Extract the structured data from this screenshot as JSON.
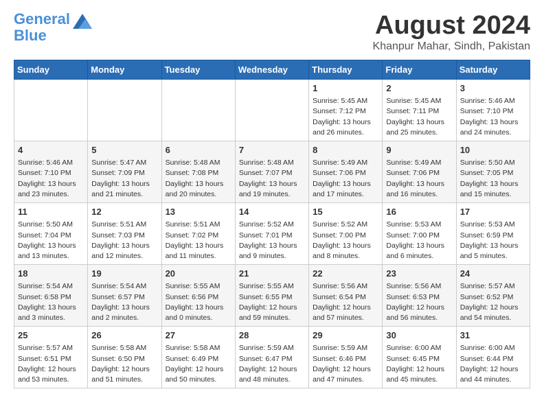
{
  "logo": {
    "line1": "General",
    "line2": "Blue"
  },
  "title": "August 2024",
  "subtitle": "Khanpur Mahar, Sindh, Pakistan",
  "headers": [
    "Sunday",
    "Monday",
    "Tuesday",
    "Wednesday",
    "Thursday",
    "Friday",
    "Saturday"
  ],
  "weeks": [
    [
      {
        "day": "",
        "info": ""
      },
      {
        "day": "",
        "info": ""
      },
      {
        "day": "",
        "info": ""
      },
      {
        "day": "",
        "info": ""
      },
      {
        "day": "1",
        "info": "Sunrise: 5:45 AM\nSunset: 7:12 PM\nDaylight: 13 hours\nand 26 minutes."
      },
      {
        "day": "2",
        "info": "Sunrise: 5:45 AM\nSunset: 7:11 PM\nDaylight: 13 hours\nand 25 minutes."
      },
      {
        "day": "3",
        "info": "Sunrise: 5:46 AM\nSunset: 7:10 PM\nDaylight: 13 hours\nand 24 minutes."
      }
    ],
    [
      {
        "day": "4",
        "info": "Sunrise: 5:46 AM\nSunset: 7:10 PM\nDaylight: 13 hours\nand 23 minutes."
      },
      {
        "day": "5",
        "info": "Sunrise: 5:47 AM\nSunset: 7:09 PM\nDaylight: 13 hours\nand 21 minutes."
      },
      {
        "day": "6",
        "info": "Sunrise: 5:48 AM\nSunset: 7:08 PM\nDaylight: 13 hours\nand 20 minutes."
      },
      {
        "day": "7",
        "info": "Sunrise: 5:48 AM\nSunset: 7:07 PM\nDaylight: 13 hours\nand 19 minutes."
      },
      {
        "day": "8",
        "info": "Sunrise: 5:49 AM\nSunset: 7:06 PM\nDaylight: 13 hours\nand 17 minutes."
      },
      {
        "day": "9",
        "info": "Sunrise: 5:49 AM\nSunset: 7:06 PM\nDaylight: 13 hours\nand 16 minutes."
      },
      {
        "day": "10",
        "info": "Sunrise: 5:50 AM\nSunset: 7:05 PM\nDaylight: 13 hours\nand 15 minutes."
      }
    ],
    [
      {
        "day": "11",
        "info": "Sunrise: 5:50 AM\nSunset: 7:04 PM\nDaylight: 13 hours\nand 13 minutes."
      },
      {
        "day": "12",
        "info": "Sunrise: 5:51 AM\nSunset: 7:03 PM\nDaylight: 13 hours\nand 12 minutes."
      },
      {
        "day": "13",
        "info": "Sunrise: 5:51 AM\nSunset: 7:02 PM\nDaylight: 13 hours\nand 11 minutes."
      },
      {
        "day": "14",
        "info": "Sunrise: 5:52 AM\nSunset: 7:01 PM\nDaylight: 13 hours\nand 9 minutes."
      },
      {
        "day": "15",
        "info": "Sunrise: 5:52 AM\nSunset: 7:00 PM\nDaylight: 13 hours\nand 8 minutes."
      },
      {
        "day": "16",
        "info": "Sunrise: 5:53 AM\nSunset: 7:00 PM\nDaylight: 13 hours\nand 6 minutes."
      },
      {
        "day": "17",
        "info": "Sunrise: 5:53 AM\nSunset: 6:59 PM\nDaylight: 13 hours\nand 5 minutes."
      }
    ],
    [
      {
        "day": "18",
        "info": "Sunrise: 5:54 AM\nSunset: 6:58 PM\nDaylight: 13 hours\nand 3 minutes."
      },
      {
        "day": "19",
        "info": "Sunrise: 5:54 AM\nSunset: 6:57 PM\nDaylight: 13 hours\nand 2 minutes."
      },
      {
        "day": "20",
        "info": "Sunrise: 5:55 AM\nSunset: 6:56 PM\nDaylight: 13 hours\nand 0 minutes."
      },
      {
        "day": "21",
        "info": "Sunrise: 5:55 AM\nSunset: 6:55 PM\nDaylight: 12 hours\nand 59 minutes."
      },
      {
        "day": "22",
        "info": "Sunrise: 5:56 AM\nSunset: 6:54 PM\nDaylight: 12 hours\nand 57 minutes."
      },
      {
        "day": "23",
        "info": "Sunrise: 5:56 AM\nSunset: 6:53 PM\nDaylight: 12 hours\nand 56 minutes."
      },
      {
        "day": "24",
        "info": "Sunrise: 5:57 AM\nSunset: 6:52 PM\nDaylight: 12 hours\nand 54 minutes."
      }
    ],
    [
      {
        "day": "25",
        "info": "Sunrise: 5:57 AM\nSunset: 6:51 PM\nDaylight: 12 hours\nand 53 minutes."
      },
      {
        "day": "26",
        "info": "Sunrise: 5:58 AM\nSunset: 6:50 PM\nDaylight: 12 hours\nand 51 minutes."
      },
      {
        "day": "27",
        "info": "Sunrise: 5:58 AM\nSunset: 6:49 PM\nDaylight: 12 hours\nand 50 minutes."
      },
      {
        "day": "28",
        "info": "Sunrise: 5:59 AM\nSunset: 6:47 PM\nDaylight: 12 hours\nand 48 minutes."
      },
      {
        "day": "29",
        "info": "Sunrise: 5:59 AM\nSunset: 6:46 PM\nDaylight: 12 hours\nand 47 minutes."
      },
      {
        "day": "30",
        "info": "Sunrise: 6:00 AM\nSunset: 6:45 PM\nDaylight: 12 hours\nand 45 minutes."
      },
      {
        "day": "31",
        "info": "Sunrise: 6:00 AM\nSunset: 6:44 PM\nDaylight: 12 hours\nand 44 minutes."
      }
    ]
  ]
}
